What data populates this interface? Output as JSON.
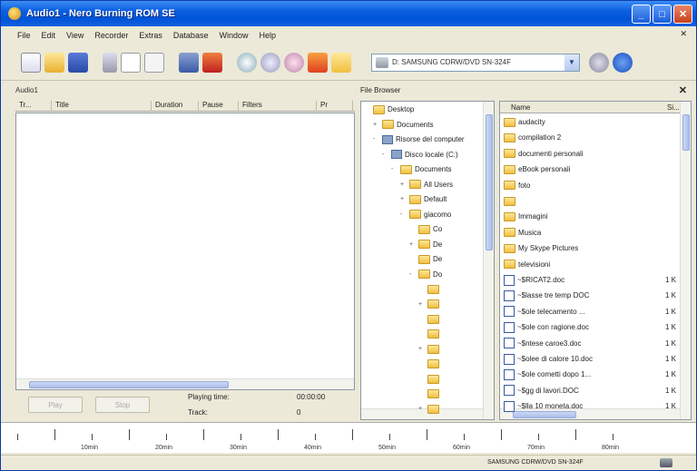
{
  "window": {
    "title": "Audio1 - Nero Burning ROM SE"
  },
  "menu": [
    "File",
    "Edit",
    "View",
    "Recorder",
    "Extras",
    "Database",
    "Window",
    "Help"
  ],
  "toolbar": {
    "drive_label": "D: SAMSUNG CDRW/DVD SN-324F",
    "icons": [
      "new-icon",
      "open-icon",
      "save-icon",
      "cut-icon",
      "copy-icon",
      "paste-icon",
      "compilation-info-icon",
      "burn-icon",
      "copy-disc-icon",
      "cd-info-icon",
      "erase-icon",
      "media-icon",
      "folder-icon",
      "drive-icon",
      "info-icon"
    ]
  },
  "compilation": {
    "label": "Audio1",
    "columns": [
      "Tr...",
      "Title",
      "Duration",
      "Pause",
      "Filters",
      "Pr"
    ],
    "play_button": "Play",
    "stop_button": "Stop",
    "playing_time_label": "Playing time:",
    "playing_time_value": "00:00:00",
    "track_label": "Track:",
    "track_value": "0"
  },
  "file_browser": {
    "title": "File Browser",
    "tree": [
      {
        "label": "Desktop",
        "indent": 0,
        "icon": "desktop",
        "expander": ""
      },
      {
        "label": "Documents",
        "indent": 1,
        "icon": "folder",
        "expander": "+"
      },
      {
        "label": "Risorse del computer",
        "indent": 1,
        "icon": "pc",
        "expander": "-"
      },
      {
        "label": "Disco locale (C:)",
        "indent": 2,
        "icon": "pc",
        "expander": "-"
      },
      {
        "label": "Documents",
        "indent": 3,
        "icon": "folder",
        "expander": "-"
      },
      {
        "label": "All Users",
        "indent": 4,
        "icon": "folder",
        "expander": "+"
      },
      {
        "label": "Default",
        "indent": 4,
        "icon": "folder",
        "expander": "+"
      },
      {
        "label": "giacomo",
        "indent": 4,
        "icon": "folder",
        "expander": "-"
      },
      {
        "label": "Co",
        "indent": 5,
        "icon": "folder",
        "expander": ""
      },
      {
        "label": "De",
        "indent": 5,
        "icon": "folder",
        "expander": "+"
      },
      {
        "label": "De",
        "indent": 5,
        "icon": "folder",
        "expander": ""
      },
      {
        "label": "Do",
        "indent": 5,
        "icon": "folder",
        "expander": "-"
      },
      {
        "label": "",
        "indent": 6,
        "icon": "folder",
        "expander": ""
      },
      {
        "label": "",
        "indent": 6,
        "icon": "folder",
        "expander": "+"
      },
      {
        "label": "",
        "indent": 6,
        "icon": "folder",
        "expander": ""
      },
      {
        "label": "",
        "indent": 6,
        "icon": "folder",
        "expander": ""
      },
      {
        "label": "",
        "indent": 6,
        "icon": "folder",
        "expander": "+"
      },
      {
        "label": "",
        "indent": 6,
        "icon": "folder",
        "expander": ""
      },
      {
        "label": "",
        "indent": 6,
        "icon": "folder",
        "expander": ""
      },
      {
        "label": "",
        "indent": 6,
        "icon": "folder",
        "expander": ""
      },
      {
        "label": "",
        "indent": 6,
        "icon": "folder",
        "expander": "+"
      }
    ],
    "file_columns": {
      "name": "Name",
      "size": "Si..."
    },
    "files": [
      {
        "name": "audacity",
        "type": "folder",
        "size": ""
      },
      {
        "name": "compilation 2",
        "type": "folder",
        "size": ""
      },
      {
        "name": "documenti personali",
        "type": "folder",
        "size": ""
      },
      {
        "name": "eBook personali",
        "type": "folder",
        "size": ""
      },
      {
        "name": "foto",
        "type": "folder",
        "size": ""
      },
      {
        "name": "",
        "type": "folder",
        "size": ""
      },
      {
        "name": "Immagini",
        "type": "folder",
        "size": ""
      },
      {
        "name": "Musica",
        "type": "folder",
        "size": ""
      },
      {
        "name": "My Skype Pictures",
        "type": "folder",
        "size": ""
      },
      {
        "name": "televisioni",
        "type": "folder",
        "size": ""
      },
      {
        "name": "~$RICAT2.doc",
        "type": "doc",
        "size": "1 K"
      },
      {
        "name": "~$lasse tre temp DOC",
        "type": "doc",
        "size": "1 K"
      },
      {
        "name": "~$ole telecamento ...",
        "type": "doc",
        "size": "1 K"
      },
      {
        "name": "~$ole con ragione.doc",
        "type": "doc",
        "size": "1 K"
      },
      {
        "name": "~$ntese caroe3.doc",
        "type": "doc",
        "size": "1 K"
      },
      {
        "name": "~$olee di calore 10.doc",
        "type": "doc",
        "size": "1 K"
      },
      {
        "name": "~$ole cometti dopo 1...",
        "type": "doc",
        "size": "1 K"
      },
      {
        "name": "~$gg di lavori.DOC",
        "type": "doc",
        "size": "1 K"
      },
      {
        "name": "~$lla 10 moneta.doc",
        "type": "doc",
        "size": "1 K"
      }
    ]
  },
  "ruler": {
    "labels": [
      "10min",
      "20min",
      "30min",
      "40min",
      "50min",
      "60min",
      "70min",
      "80min"
    ]
  },
  "status": {
    "drive": "SAMSUNG CDRW/DVD SN-324F"
  },
  "colors": {
    "title_bar": "#0054d8",
    "window_bg": "#ece9d8",
    "folder": "#f0c040"
  }
}
